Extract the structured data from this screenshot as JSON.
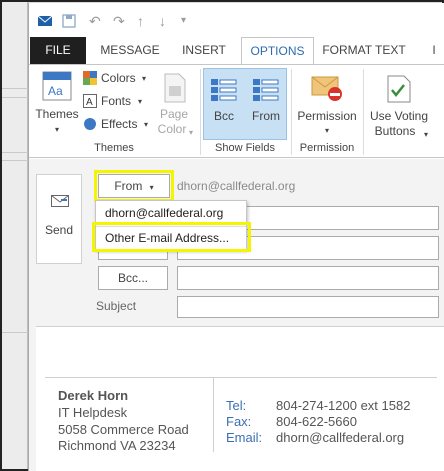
{
  "ribbon_tabs": [
    "FILE",
    "MESSAGE",
    "INSERT",
    "OPTIONS",
    "FORMAT TEXT",
    "I"
  ],
  "ribbon": {
    "themes_group": {
      "themes_label": "Themes",
      "colors_label": "Colors",
      "fonts_label": "Fonts",
      "effects_label": "Effects",
      "page_color_line1": "Page",
      "page_color_line2": "Color",
      "group_label": "Themes"
    },
    "show_fields_group": {
      "bcc_label": "Bcc",
      "from_label": "From",
      "group_label": "Show Fields"
    },
    "permission_group": {
      "permission_label": "Permission",
      "group_label": "Permission"
    },
    "voting_group": {
      "line1": "Use Voting",
      "line2": "Buttons"
    }
  },
  "compose": {
    "send_label": "Send",
    "from_button_label": "From",
    "from_address": "dhorn@callfederal.org",
    "from_dropdown": {
      "items": [
        "dhorn@callfederal.org",
        "Other E-mail Address..."
      ]
    },
    "bcc_button_label": "Bcc...",
    "subject_label": "Subject"
  },
  "signature": {
    "name": "Derek Horn",
    "title": "IT Helpdesk",
    "street": "5058 Commerce Road",
    "city": "Richmond VA 23234",
    "tel_label": "Tel:",
    "tel_value": "804-274-1200 ext 1582",
    "fax_label": "Fax:",
    "fax_value": "804-622-5660",
    "email_label": "Email:",
    "email_value": "dhorn@callfederal.org"
  },
  "colors": {
    "highlight": "#f5f500",
    "accent": "#2b6cb0",
    "file_tab": "#1f1f1f",
    "signature_link": "#3a6fb5"
  },
  "icons": [
    "save-icon",
    "undo-icon",
    "redo-icon",
    "up-arrow-icon",
    "down-arrow-icon",
    "customize-icon",
    "send-icon",
    "themes-icon",
    "colors-icon",
    "fonts-icon",
    "effects-icon",
    "page-color-icon",
    "bcc-icon",
    "from-icon",
    "permission-icon",
    "voting-icon",
    "chevron-down-icon"
  ]
}
